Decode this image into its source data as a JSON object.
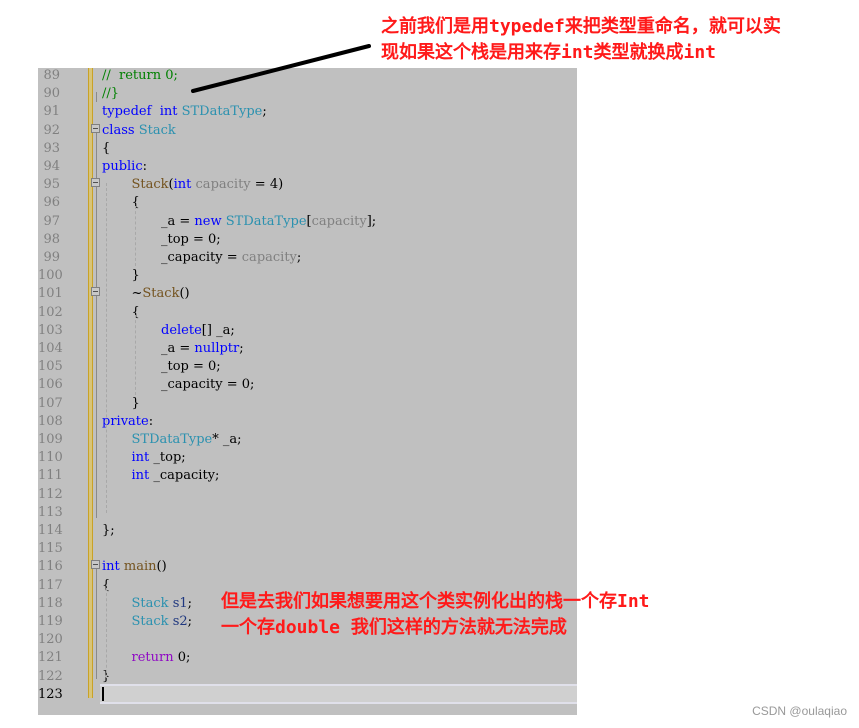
{
  "annotations": {
    "top_line1": "之前我们是用typedef来把类型重命名，就可以实",
    "top_line2": "现如果这个栈是用来存int类型就换成int",
    "bottom_line1": "但是去我们如果想要用这个类实例化出的栈一个存Int",
    "bottom_line2": "一个存double 我们这样的方法就无法完成"
  },
  "watermark": "CSDN @oulaqiao",
  "editor": {
    "current_line": 123,
    "lines": [
      {
        "n": "89",
        "tokens": [
          [
            "cm",
            "//  return 0;"
          ]
        ],
        "indent": 0
      },
      {
        "n": "90",
        "tokens": [
          [
            "cm",
            "//}"
          ]
        ],
        "indent": 0
      },
      {
        "n": "91",
        "tokens": [
          [
            "kw",
            "typedef"
          ],
          [
            "tx",
            "  "
          ],
          [
            "kw",
            "int"
          ],
          [
            "tx",
            " "
          ],
          [
            "ty",
            "STDataType"
          ],
          [
            "tx",
            ";"
          ]
        ],
        "indent": 0
      },
      {
        "n": "92",
        "tokens": [
          [
            "kw",
            "class"
          ],
          [
            "tx",
            " "
          ],
          [
            "ty",
            "Stack"
          ]
        ],
        "indent": 0
      },
      {
        "n": "93",
        "tokens": [
          [
            "tx",
            "{"
          ]
        ],
        "indent": 0
      },
      {
        "n": "94",
        "tokens": [
          [
            "kw",
            "public"
          ],
          [
            "tx",
            ":"
          ]
        ],
        "indent": 0
      },
      {
        "n": "95",
        "tokens": [
          [
            "fn",
            "Stack"
          ],
          [
            "tx",
            "("
          ],
          [
            "kw",
            "int"
          ],
          [
            "tx",
            " "
          ],
          [
            "pm",
            "capacity"
          ],
          [
            "tx",
            " = 4)"
          ]
        ],
        "indent": 1
      },
      {
        "n": "96",
        "tokens": [
          [
            "tx",
            "{"
          ]
        ],
        "indent": 1
      },
      {
        "n": "97",
        "tokens": [
          [
            "tx",
            "_a = "
          ],
          [
            "kw",
            "new"
          ],
          [
            "tx",
            " "
          ],
          [
            "ty",
            "STDataType"
          ],
          [
            "tx",
            "["
          ],
          [
            "pm",
            "capacity"
          ],
          [
            "tx",
            "];"
          ]
        ],
        "indent": 2
      },
      {
        "n": "98",
        "tokens": [
          [
            "tx",
            "_top = 0;"
          ]
        ],
        "indent": 2
      },
      {
        "n": "99",
        "tokens": [
          [
            "tx",
            "_capacity = "
          ],
          [
            "pm",
            "capacity"
          ],
          [
            "tx",
            ";"
          ]
        ],
        "indent": 2
      },
      {
        "n": "100",
        "tokens": [
          [
            "tx",
            "}"
          ]
        ],
        "indent": 1
      },
      {
        "n": "101",
        "tokens": [
          [
            "tx",
            "~"
          ],
          [
            "fn",
            "Stack"
          ],
          [
            "tx",
            "()"
          ]
        ],
        "indent": 1
      },
      {
        "n": "102",
        "tokens": [
          [
            "tx",
            "{"
          ]
        ],
        "indent": 1
      },
      {
        "n": "103",
        "tokens": [
          [
            "kw",
            "delete"
          ],
          [
            "tx",
            "[] _a;"
          ]
        ],
        "indent": 2
      },
      {
        "n": "104",
        "tokens": [
          [
            "tx",
            "_a = "
          ],
          [
            "kw",
            "nullptr"
          ],
          [
            "tx",
            ";"
          ]
        ],
        "indent": 2
      },
      {
        "n": "105",
        "tokens": [
          [
            "tx",
            "_top = 0;"
          ]
        ],
        "indent": 2
      },
      {
        "n": "106",
        "tokens": [
          [
            "tx",
            "_capacity = 0;"
          ]
        ],
        "indent": 2
      },
      {
        "n": "107",
        "tokens": [
          [
            "tx",
            "}"
          ]
        ],
        "indent": 1
      },
      {
        "n": "108",
        "tokens": [
          [
            "kw",
            "private"
          ],
          [
            "tx",
            ":"
          ]
        ],
        "indent": 0
      },
      {
        "n": "109",
        "tokens": [
          [
            "ty",
            "STDataType"
          ],
          [
            "tx",
            "* _a;"
          ]
        ],
        "indent": 1
      },
      {
        "n": "110",
        "tokens": [
          [
            "kw",
            "int"
          ],
          [
            "tx",
            " _top;"
          ]
        ],
        "indent": 1
      },
      {
        "n": "111",
        "tokens": [
          [
            "kw",
            "int"
          ],
          [
            "tx",
            " _capacity;"
          ]
        ],
        "indent": 1
      },
      {
        "n": "112",
        "tokens": [],
        "indent": 0
      },
      {
        "n": "113",
        "tokens": [],
        "indent": 0
      },
      {
        "n": "114",
        "tokens": [
          [
            "tx",
            "};"
          ]
        ],
        "indent": 0
      },
      {
        "n": "115",
        "tokens": [],
        "indent": 0
      },
      {
        "n": "116",
        "tokens": [
          [
            "kw",
            "int"
          ],
          [
            "tx",
            " "
          ],
          [
            "fn",
            "main"
          ],
          [
            "tx",
            "()"
          ]
        ],
        "indent": 0
      },
      {
        "n": "117",
        "tokens": [
          [
            "tx",
            "{"
          ]
        ],
        "indent": 0
      },
      {
        "n": "118",
        "tokens": [
          [
            "ty",
            "Stack"
          ],
          [
            "tx",
            " "
          ],
          [
            "id",
            "s1"
          ],
          [
            "tx",
            ";"
          ]
        ],
        "indent": 1
      },
      {
        "n": "119",
        "tokens": [
          [
            "ty",
            "Stack"
          ],
          [
            "tx",
            " "
          ],
          [
            "id",
            "s2"
          ],
          [
            "tx",
            ";"
          ]
        ],
        "indent": 1
      },
      {
        "n": "120",
        "tokens": [],
        "indent": 0
      },
      {
        "n": "121",
        "tokens": [
          [
            "ret",
            "return"
          ],
          [
            "tx",
            " 0;"
          ]
        ],
        "indent": 1
      },
      {
        "n": "122",
        "tokens": [
          [
            "tx",
            "}"
          ]
        ],
        "indent": 0
      },
      {
        "n": "123",
        "tokens": [],
        "indent": 0
      }
    ]
  }
}
